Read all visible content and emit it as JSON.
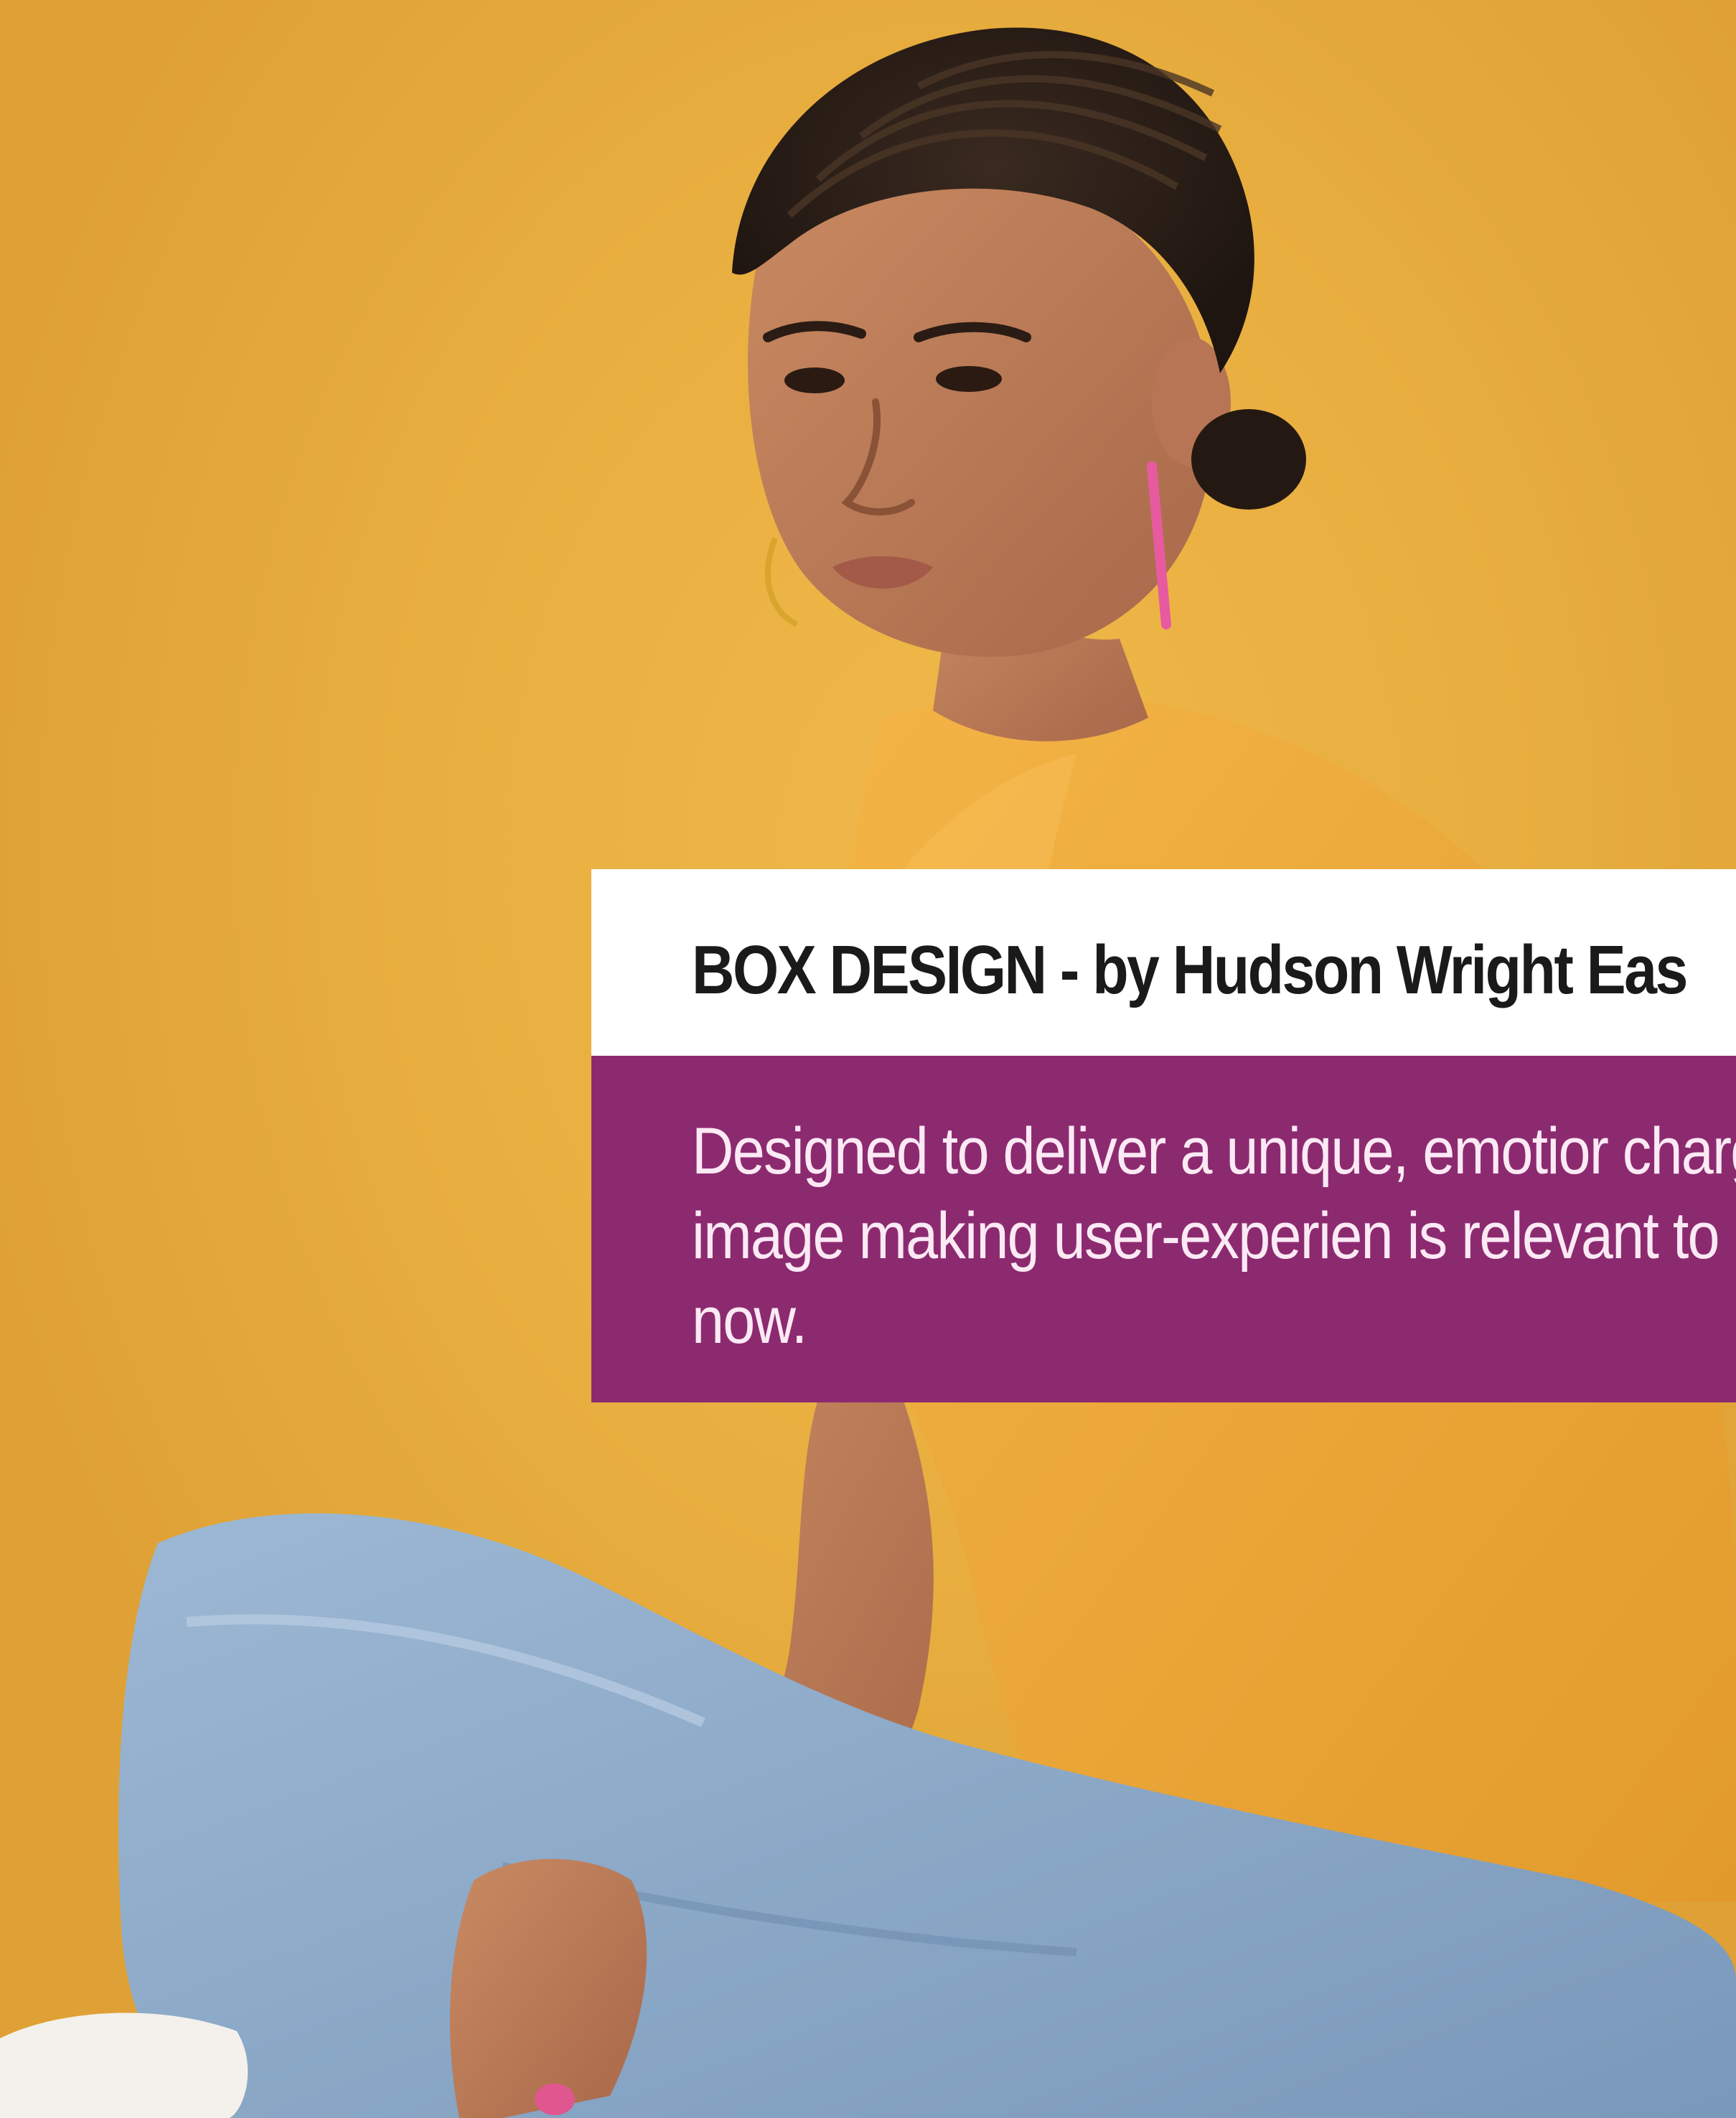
{
  "caption": {
    "title": "BOX DESIGN - by Hudson Wright Eas",
    "body": "Designed to deliver a unique, emotior charged image making user-experien is relevant to now."
  },
  "colors": {
    "background": "#e8ae3f",
    "caption_title_bg": "#ffffff",
    "caption_body_bg": "#8c2a70",
    "shirt": "#f0ad3c",
    "jeans": "#8aa8c8"
  },
  "photo_subject": "person-sitting-cross-legged"
}
